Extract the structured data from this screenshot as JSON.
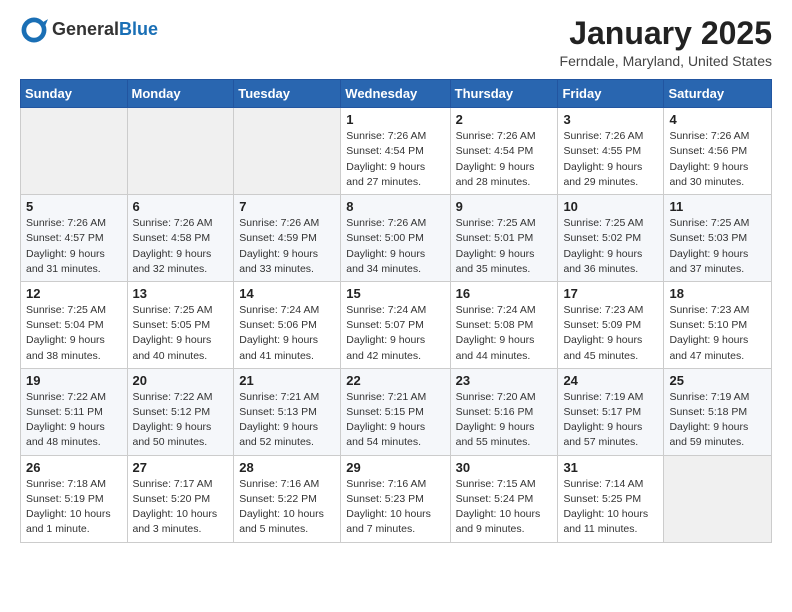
{
  "header": {
    "logo_general": "General",
    "logo_blue": "Blue",
    "month_title": "January 2025",
    "location": "Ferndale, Maryland, United States"
  },
  "weekdays": [
    "Sunday",
    "Monday",
    "Tuesday",
    "Wednesday",
    "Thursday",
    "Friday",
    "Saturday"
  ],
  "weeks": [
    [
      {
        "day": "",
        "info": ""
      },
      {
        "day": "",
        "info": ""
      },
      {
        "day": "",
        "info": ""
      },
      {
        "day": "1",
        "info": "Sunrise: 7:26 AM\nSunset: 4:54 PM\nDaylight: 9 hours and 27 minutes."
      },
      {
        "day": "2",
        "info": "Sunrise: 7:26 AM\nSunset: 4:54 PM\nDaylight: 9 hours and 28 minutes."
      },
      {
        "day": "3",
        "info": "Sunrise: 7:26 AM\nSunset: 4:55 PM\nDaylight: 9 hours and 29 minutes."
      },
      {
        "day": "4",
        "info": "Sunrise: 7:26 AM\nSunset: 4:56 PM\nDaylight: 9 hours and 30 minutes."
      }
    ],
    [
      {
        "day": "5",
        "info": "Sunrise: 7:26 AM\nSunset: 4:57 PM\nDaylight: 9 hours and 31 minutes."
      },
      {
        "day": "6",
        "info": "Sunrise: 7:26 AM\nSunset: 4:58 PM\nDaylight: 9 hours and 32 minutes."
      },
      {
        "day": "7",
        "info": "Sunrise: 7:26 AM\nSunset: 4:59 PM\nDaylight: 9 hours and 33 minutes."
      },
      {
        "day": "8",
        "info": "Sunrise: 7:26 AM\nSunset: 5:00 PM\nDaylight: 9 hours and 34 minutes."
      },
      {
        "day": "9",
        "info": "Sunrise: 7:25 AM\nSunset: 5:01 PM\nDaylight: 9 hours and 35 minutes."
      },
      {
        "day": "10",
        "info": "Sunrise: 7:25 AM\nSunset: 5:02 PM\nDaylight: 9 hours and 36 minutes."
      },
      {
        "day": "11",
        "info": "Sunrise: 7:25 AM\nSunset: 5:03 PM\nDaylight: 9 hours and 37 minutes."
      }
    ],
    [
      {
        "day": "12",
        "info": "Sunrise: 7:25 AM\nSunset: 5:04 PM\nDaylight: 9 hours and 38 minutes."
      },
      {
        "day": "13",
        "info": "Sunrise: 7:25 AM\nSunset: 5:05 PM\nDaylight: 9 hours and 40 minutes."
      },
      {
        "day": "14",
        "info": "Sunrise: 7:24 AM\nSunset: 5:06 PM\nDaylight: 9 hours and 41 minutes."
      },
      {
        "day": "15",
        "info": "Sunrise: 7:24 AM\nSunset: 5:07 PM\nDaylight: 9 hours and 42 minutes."
      },
      {
        "day": "16",
        "info": "Sunrise: 7:24 AM\nSunset: 5:08 PM\nDaylight: 9 hours and 44 minutes."
      },
      {
        "day": "17",
        "info": "Sunrise: 7:23 AM\nSunset: 5:09 PM\nDaylight: 9 hours and 45 minutes."
      },
      {
        "day": "18",
        "info": "Sunrise: 7:23 AM\nSunset: 5:10 PM\nDaylight: 9 hours and 47 minutes."
      }
    ],
    [
      {
        "day": "19",
        "info": "Sunrise: 7:22 AM\nSunset: 5:11 PM\nDaylight: 9 hours and 48 minutes."
      },
      {
        "day": "20",
        "info": "Sunrise: 7:22 AM\nSunset: 5:12 PM\nDaylight: 9 hours and 50 minutes."
      },
      {
        "day": "21",
        "info": "Sunrise: 7:21 AM\nSunset: 5:13 PM\nDaylight: 9 hours and 52 minutes."
      },
      {
        "day": "22",
        "info": "Sunrise: 7:21 AM\nSunset: 5:15 PM\nDaylight: 9 hours and 54 minutes."
      },
      {
        "day": "23",
        "info": "Sunrise: 7:20 AM\nSunset: 5:16 PM\nDaylight: 9 hours and 55 minutes."
      },
      {
        "day": "24",
        "info": "Sunrise: 7:19 AM\nSunset: 5:17 PM\nDaylight: 9 hours and 57 minutes."
      },
      {
        "day": "25",
        "info": "Sunrise: 7:19 AM\nSunset: 5:18 PM\nDaylight: 9 hours and 59 minutes."
      }
    ],
    [
      {
        "day": "26",
        "info": "Sunrise: 7:18 AM\nSunset: 5:19 PM\nDaylight: 10 hours and 1 minute."
      },
      {
        "day": "27",
        "info": "Sunrise: 7:17 AM\nSunset: 5:20 PM\nDaylight: 10 hours and 3 minutes."
      },
      {
        "day": "28",
        "info": "Sunrise: 7:16 AM\nSunset: 5:22 PM\nDaylight: 10 hours and 5 minutes."
      },
      {
        "day": "29",
        "info": "Sunrise: 7:16 AM\nSunset: 5:23 PM\nDaylight: 10 hours and 7 minutes."
      },
      {
        "day": "30",
        "info": "Sunrise: 7:15 AM\nSunset: 5:24 PM\nDaylight: 10 hours and 9 minutes."
      },
      {
        "day": "31",
        "info": "Sunrise: 7:14 AM\nSunset: 5:25 PM\nDaylight: 10 hours and 11 minutes."
      },
      {
        "day": "",
        "info": ""
      }
    ]
  ]
}
